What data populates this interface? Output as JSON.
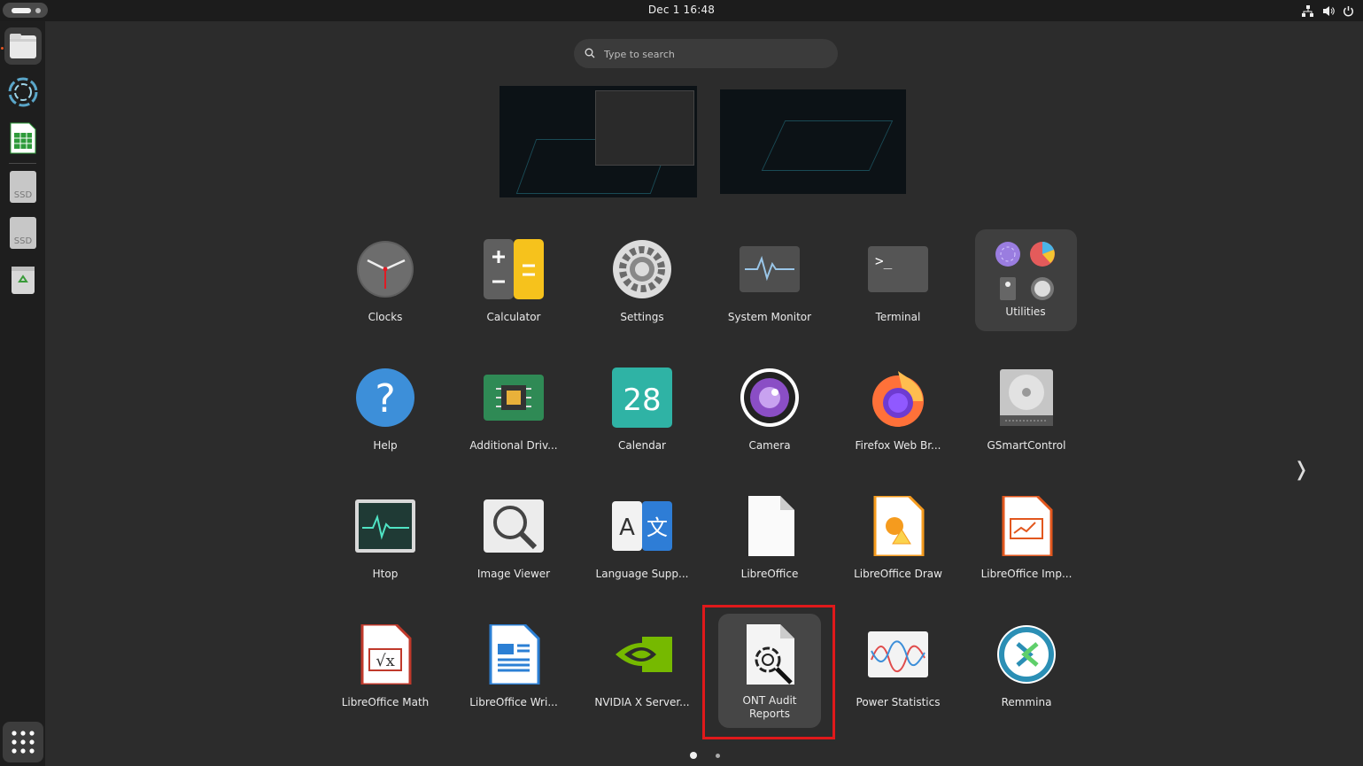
{
  "topbar": {
    "datetime": "Dec 1  16:48",
    "tray_icons": [
      "network-icon",
      "volume-icon",
      "power-icon"
    ]
  },
  "dock": {
    "items": [
      "files-icon",
      "ont-audit-icon",
      "libreoffice-calc-icon",
      "ssd-drive-icon",
      "ssd-drive-icon",
      "trash-icon"
    ],
    "ssd_label": "SSD"
  },
  "search": {
    "placeholder": "Type to search"
  },
  "apps": {
    "row1": [
      "Clocks",
      "Calculator",
      "Settings",
      "System Monitor",
      "Terminal",
      "Utilities"
    ],
    "row2": [
      "Help",
      "Additional Driv...",
      "Calendar",
      "Camera",
      "Firefox Web Br...",
      "GSmartControl"
    ],
    "row3": [
      "Htop",
      "Image Viewer",
      "Language Supp...",
      "LibreOffice",
      "LibreOffice Draw",
      "LibreOffice Imp..."
    ],
    "row4": [
      "LibreOffice Math",
      "LibreOffice Wri...",
      "NVIDIA X Server...",
      "ONT Audit Reports",
      "Power Statistics",
      "Remmina"
    ]
  },
  "calendar_day": "28",
  "terminal_prompt": ">_",
  "selected_app": "ONT Audit Reports",
  "pages": {
    "current": 1,
    "total": 2
  },
  "colors": {
    "highlight": "#e0191b",
    "accent": "#e95420"
  }
}
